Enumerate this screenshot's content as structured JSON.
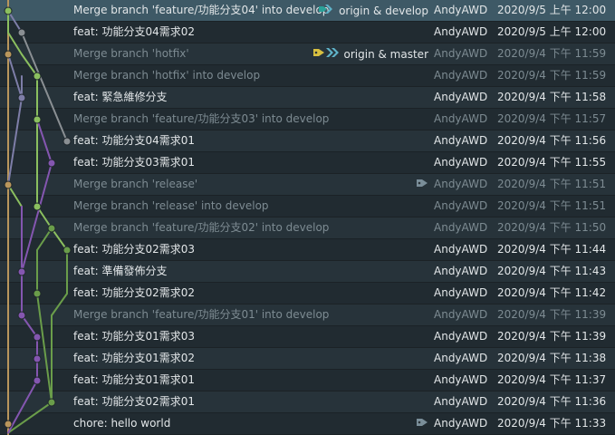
{
  "colors": {
    "lane0": "#b9965c",
    "lane1": "#8bbf5f",
    "lane2": "#7e7ea8",
    "lane3": "#8a8f93",
    "lane4": "#8456b0",
    "lane5": "#6a9d4a"
  },
  "commits": [
    {
      "message": "Merge branch 'feature/功能分支04' into develop",
      "author": "AndyAWD",
      "date": "2020/9/5 上午 12:00",
      "refs": {
        "icon": "branch-chevron-teal-icon",
        "label": "origin & develop"
      },
      "state": "selected"
    },
    {
      "message": "feat: 功能分支04需求02",
      "author": "AndyAWD",
      "date": "2020/9/5 上午 12:00",
      "refs": null,
      "state": "normal"
    },
    {
      "message": "Merge branch 'hotfix'",
      "author": "AndyAWD",
      "date": "2020/9/4 下午 11:59",
      "refs": {
        "icon": "tag-and-branch-chevron-icon",
        "label": "origin & master"
      },
      "state": "dim"
    },
    {
      "message": "Merge branch 'hotfix' into develop",
      "author": "AndyAWD",
      "date": "2020/9/4 下午 11:59",
      "refs": null,
      "state": "dim"
    },
    {
      "message": "feat: 緊急維修分支",
      "author": "AndyAWD",
      "date": "2020/9/4 下午 11:58",
      "refs": null,
      "state": "normal"
    },
    {
      "message": "Merge branch 'feature/功能分支03' into develop",
      "author": "AndyAWD",
      "date": "2020/9/4 下午 11:57",
      "refs": null,
      "state": "dim"
    },
    {
      "message": "feat: 功能分支04需求01",
      "author": "AndyAWD",
      "date": "2020/9/4 下午 11:56",
      "refs": null,
      "state": "normal"
    },
    {
      "message": "feat: 功能分支03需求01",
      "author": "AndyAWD",
      "date": "2020/9/4 下午 11:55",
      "refs": null,
      "state": "normal"
    },
    {
      "message": "Merge branch 'release'",
      "author": "AndyAWD",
      "date": "2020/9/4 下午 11:51",
      "refs": {
        "icon": "tag-icon",
        "label": ""
      },
      "state": "dim"
    },
    {
      "message": "Merge branch 'release' into develop",
      "author": "AndyAWD",
      "date": "2020/9/4 下午 11:51",
      "refs": null,
      "state": "dim"
    },
    {
      "message": "Merge branch 'feature/功能分支02' into develop",
      "author": "AndyAWD",
      "date": "2020/9/4 下午 11:50",
      "refs": null,
      "state": "dim"
    },
    {
      "message": "feat: 功能分支02需求03",
      "author": "AndyAWD",
      "date": "2020/9/4 下午 11:44",
      "refs": null,
      "state": "normal"
    },
    {
      "message": "feat: 準備發佈分支",
      "author": "AndyAWD",
      "date": "2020/9/4 下午 11:43",
      "refs": null,
      "state": "normal"
    },
    {
      "message": "feat: 功能分支02需求02",
      "author": "AndyAWD",
      "date": "2020/9/4 下午 11:42",
      "refs": null,
      "state": "normal"
    },
    {
      "message": "Merge branch 'feature/功能分支01' into develop",
      "author": "AndyAWD",
      "date": "2020/9/4 下午 11:39",
      "refs": null,
      "state": "dim"
    },
    {
      "message": "feat: 功能分支01需求03",
      "author": "AndyAWD",
      "date": "2020/9/4 下午 11:39",
      "refs": null,
      "state": "normal"
    },
    {
      "message": "feat: 功能分支01需求02",
      "author": "AndyAWD",
      "date": "2020/9/4 下午 11:38",
      "refs": null,
      "state": "normal"
    },
    {
      "message": "feat: 功能分支01需求01",
      "author": "AndyAWD",
      "date": "2020/9/4 下午 11:37",
      "refs": null,
      "state": "normal"
    },
    {
      "message": "feat: 功能分支02需求01",
      "author": "AndyAWD",
      "date": "2020/9/4 下午 11:36",
      "refs": null,
      "state": "normal"
    },
    {
      "message": "chore: hello world",
      "author": "AndyAWD",
      "date": "2020/9/4 下午 11:33",
      "refs": {
        "icon": "tag-icon",
        "label": ""
      },
      "state": "normal"
    }
  ]
}
